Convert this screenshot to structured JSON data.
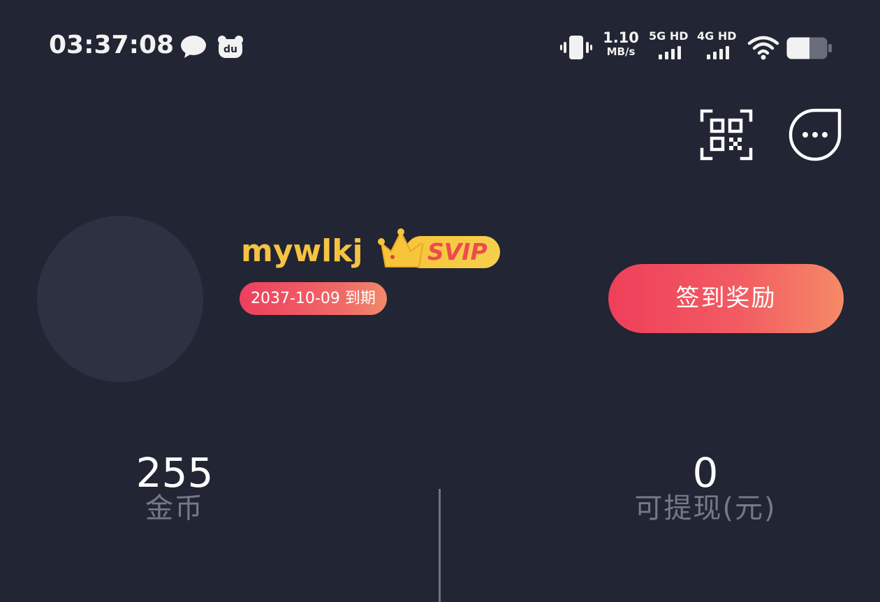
{
  "status_bar": {
    "time": "03:37:08",
    "net_speed_value": "1.10",
    "net_speed_unit": "MB/s",
    "sim1_label": "5G HD",
    "sim2_label": "4G HD",
    "icons": [
      "chat-bubble-icon",
      "du-app-icon",
      "vibrate-icon",
      "wifi-icon",
      "battery-icon"
    ]
  },
  "header_actions": {
    "icons": [
      "qr-scan-icon",
      "message-more-icon"
    ]
  },
  "profile": {
    "username": "mywlkj",
    "vip_label": "SVIP",
    "expiry_text": "2037-10-09 到期",
    "sign_in_button": "签到奖励"
  },
  "stats": [
    {
      "value": "255",
      "label": "金币"
    },
    {
      "value": "0",
      "label": "可提现(元)"
    }
  ],
  "colors": {
    "background": "#222533",
    "username": "#f5c243",
    "vip_gold": "#f7c53a",
    "vip_text": "#ef4a4f",
    "accent_start": "#ef3f5a",
    "accent_end": "#f58a66",
    "stat_label": "#767a88"
  }
}
